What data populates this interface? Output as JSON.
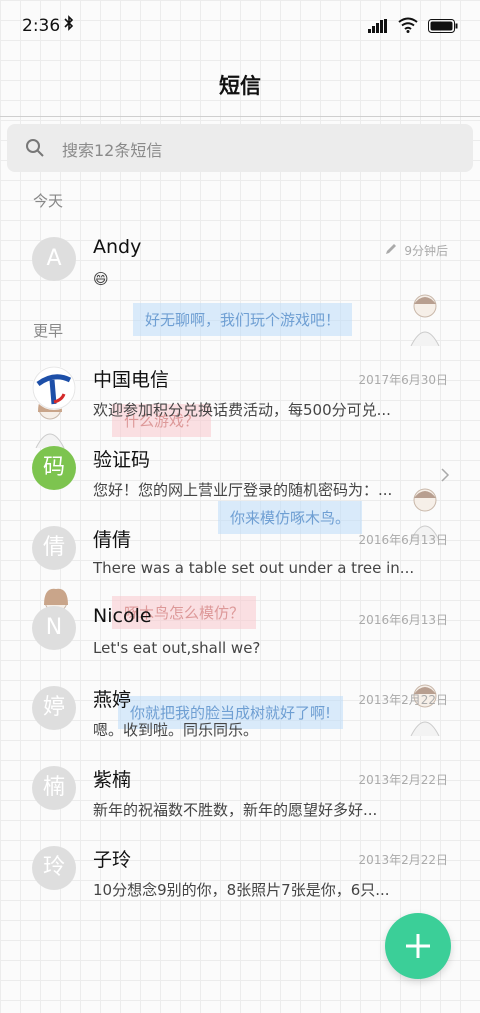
{
  "status_bar": {
    "time": "2:36"
  },
  "header": {
    "title": "短信"
  },
  "search": {
    "placeholder": "搜索12条短信"
  },
  "sections": {
    "today": "今天",
    "earlier": "更早"
  },
  "conversations": [
    {
      "avatar": "A",
      "name": "Andy",
      "snippet": "😄",
      "date": "9分钟后",
      "draft": true
    },
    {
      "avatar": "",
      "name": "中国电信",
      "snippet": "欢迎参加积分兑换话费活动，每500分可兑...",
      "date": "2017年6月30日",
      "logo": "china-telecom-logo"
    },
    {
      "avatar": "码",
      "name": "验证码",
      "snippet": "您好！您的网上营业厅登录的随机密码为：...",
      "date": ""
    },
    {
      "avatar": "倩",
      "name": "倩倩",
      "snippet": "There was a table set out under a tree in...",
      "date": "2016年6月13日"
    },
    {
      "avatar": "N",
      "name": "Nicole",
      "snippet": "Let's eat out,shall we?",
      "date": "2016年6月13日"
    },
    {
      "avatar": "婷",
      "name": "燕婷",
      "snippet": "嗯。收到啦。同乐同乐。",
      "date": "2013年2月22日"
    },
    {
      "avatar": "楠",
      "name": "紫楠",
      "snippet": "新年的祝福数不胜数，新年的愿望好多好...",
      "date": "2013年2月22日"
    },
    {
      "avatar": "玲",
      "name": "子玲",
      "snippet": "10分想念9别的你，8张照片7张是你，6只...",
      "date": "2013年2月22日"
    }
  ],
  "wallpaper_bubbles": [
    "好无聊啊，我们玩个游戏吧！",
    "什么游戏？",
    "你来模仿啄木鸟。",
    "啄木鸟怎么模仿？",
    "你就把我的脸当成树就好了啊!"
  ],
  "fab": {
    "icon": "plus-icon"
  },
  "colors": {
    "accent": "#3bcf98",
    "avatar_default": "#dedede",
    "avatar_green": "#7dc44f"
  }
}
